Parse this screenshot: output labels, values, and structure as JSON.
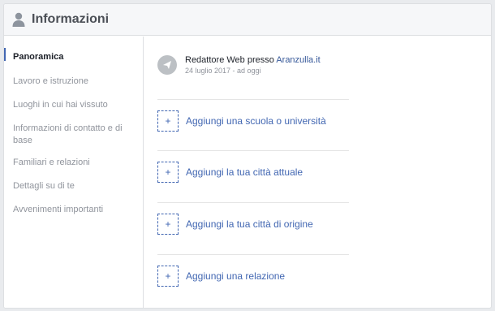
{
  "header": {
    "title": "Informazioni",
    "icon": "person-icon"
  },
  "sidebar": {
    "items": [
      {
        "label": "Panoramica",
        "active": true
      },
      {
        "label": "Lavoro e istruzione",
        "active": false
      },
      {
        "label": "Luoghi in cui hai vissuto",
        "active": false
      },
      {
        "label": "Informazioni di contatto e di base",
        "active": false
      },
      {
        "label": "Familiari e relazioni",
        "active": false
      },
      {
        "label": "Dettagli su di te",
        "active": false
      },
      {
        "label": "Avvenimenti importanti",
        "active": false
      }
    ]
  },
  "main": {
    "job": {
      "role_prefix": "Redattore Web presso ",
      "company": "Aranzulla.it",
      "dates": "24 luglio 2017 - ad oggi",
      "icon": "briefcase-icon"
    },
    "add_actions": [
      {
        "label": "Aggiungi una scuola o università",
        "icon": "plus-icon"
      },
      {
        "label": "Aggiungi la tua città attuale",
        "icon": "plus-icon"
      },
      {
        "label": "Aggiungi la tua città di origine",
        "icon": "plus-icon"
      },
      {
        "label": "Aggiungi una relazione",
        "icon": "plus-icon"
      }
    ]
  },
  "colors": {
    "accent": "#4267b2",
    "link": "#365899",
    "muted_text": "#90949c",
    "header_bg": "#f6f7f9"
  }
}
